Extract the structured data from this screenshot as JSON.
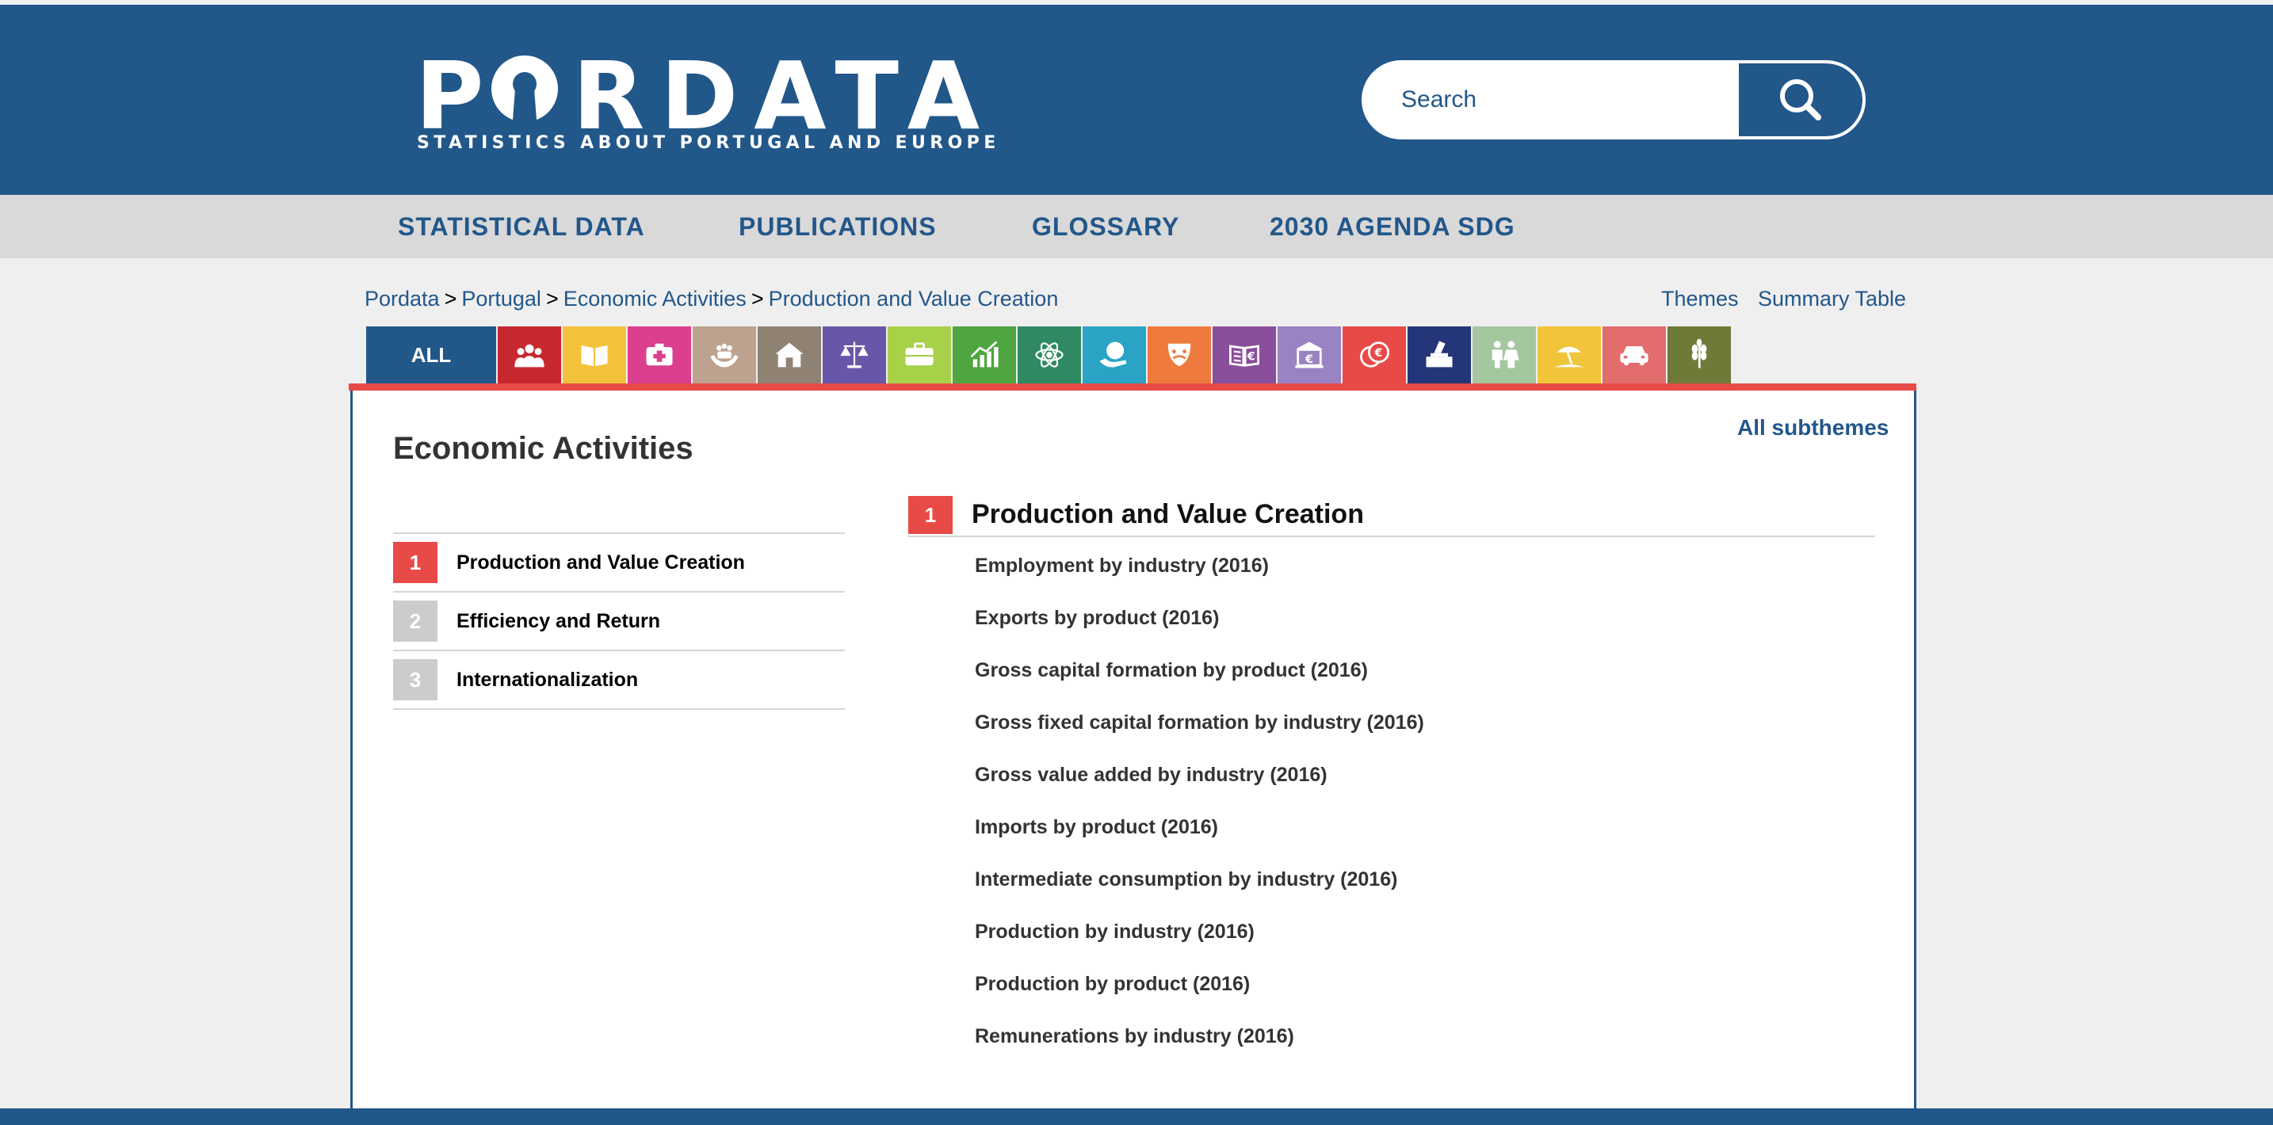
{
  "header": {
    "logo_text_left": "P",
    "logo_text_right": "RDATA",
    "logo_subtitle": "STATISTICS ABOUT PORTUGAL AND EUROPE",
    "search_placeholder": "Search"
  },
  "nav": {
    "items": [
      {
        "label": "STATISTICAL DATA"
      },
      {
        "label": "PUBLICATIONS"
      },
      {
        "label": "GLOSSARY"
      },
      {
        "label": "2030 AGENDA SDG"
      }
    ]
  },
  "breadcrumb": {
    "items": [
      "Pordata",
      "Portugal",
      "Economic Activities",
      "Production and Value Creation"
    ],
    "separator": ">"
  },
  "top_links": {
    "themes": "Themes",
    "summary_table": "Summary Table"
  },
  "themes": {
    "all_label": "ALL",
    "icons": [
      {
        "name": "population-icon",
        "color": "#c7282f"
      },
      {
        "name": "education-icon",
        "color": "#f4c23a"
      },
      {
        "name": "health-icon",
        "color": "#db3f8e"
      },
      {
        "name": "social-protection-icon",
        "color": "#bda28f"
      },
      {
        "name": "housing-icon",
        "color": "#8f8273"
      },
      {
        "name": "justice-icon",
        "color": "#6857a8"
      },
      {
        "name": "employment-icon",
        "color": "#a8d14a"
      },
      {
        "name": "economy-icon",
        "color": "#4fa53f"
      },
      {
        "name": "science-icon",
        "color": "#2f8a63"
      },
      {
        "name": "environment-icon",
        "color": "#2aa3c4"
      },
      {
        "name": "culture-icon",
        "color": "#ee7a3e"
      },
      {
        "name": "libraries-icon",
        "color": "#8a4f9a"
      },
      {
        "name": "public-finance-icon",
        "color": "#9a83c2"
      },
      {
        "name": "money-icon",
        "color": "#e84a48"
      },
      {
        "name": "elections-icon",
        "color": "#243679"
      },
      {
        "name": "family-icon",
        "color": "#a4c7a0"
      },
      {
        "name": "tourism-icon",
        "color": "#f2c43a"
      },
      {
        "name": "transport-icon",
        "color": "#e36c6c"
      },
      {
        "name": "agriculture-icon",
        "color": "#6f7a38"
      }
    ]
  },
  "main": {
    "all_subthemes": "All subthemes",
    "title": "Economic Activities",
    "subthemes": [
      {
        "num": "1",
        "label": "Production and Value Creation",
        "active": true
      },
      {
        "num": "2",
        "label": "Efficiency and Return",
        "active": false
      },
      {
        "num": "3",
        "label": "Internationalization",
        "active": false
      }
    ],
    "section": {
      "num": "1",
      "title": "Production and Value Creation",
      "tables": [
        "Employment by industry (2016)",
        "Exports by product (2016)",
        "Gross capital formation by product (2016)",
        "Gross fixed capital formation by industry (2016)",
        "Gross value added by industry (2016)",
        "Imports by product (2016)",
        "Intermediate consumption by industry (2016)",
        "Production by industry (2016)",
        "Production by product (2016)",
        "Remunerations by industry (2016)"
      ]
    }
  },
  "colors": {
    "brand_blue": "#22578a",
    "accent_red": "#e84a48",
    "inactive_grey": "#cccccc"
  }
}
